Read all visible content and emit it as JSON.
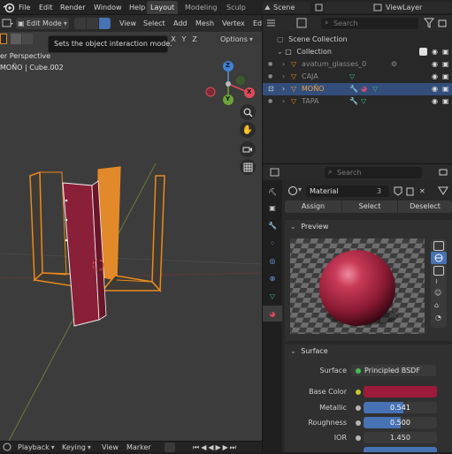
{
  "menu": {
    "file": "File",
    "edit": "Edit",
    "render": "Render",
    "window": "Window",
    "help": "Help"
  },
  "workspaces": [
    "Layout",
    "Modeling",
    "Sculp"
  ],
  "scene": {
    "name": "Scene",
    "view_layer": "ViewLayer"
  },
  "viewport": {
    "mode": "Edit Mode",
    "view_menu": "View",
    "select_menu": "Select",
    "add_menu": "Add",
    "mesh_menu": "Mesh",
    "vertex_menu": "Vertex",
    "edge_menu": "Ed",
    "axes": [
      "X",
      "Y",
      "Z"
    ],
    "options": "Options",
    "perspective": "er Perspective",
    "object_info": "MOÑO | Cube.002",
    "tooltip": "Sets the object interaction mode.",
    "gizmo": {
      "x": "X",
      "y": "Y",
      "z": "Z"
    }
  },
  "outliner": {
    "search_placeholder": "Search",
    "scene_collection": "Scene Collection",
    "collection": "Collection",
    "items": [
      "avatum_glasses_0",
      "CAJA",
      "MOÑO",
      "TAPA"
    ]
  },
  "properties": {
    "search_placeholder": "Search",
    "material_name": "Material",
    "material_users": "3",
    "assign": "Assign",
    "select": "Select",
    "deselect": "Deselect",
    "preview_header": "Preview",
    "surface_header": "Surface",
    "surface_label": "Surface",
    "surface_value": "Principled BSDF",
    "base_color_label": "Base Color",
    "base_color": "#9c1b3a",
    "metallic_label": "Metallic",
    "metallic_value": "0.541",
    "metallic_fraction": 0.541,
    "roughness_label": "Roughness",
    "roughness_value": "0.500",
    "roughness_fraction": 0.5,
    "ior_label": "IOR",
    "ior_value": "1.450"
  },
  "timeline": {
    "playback": "Playback",
    "keying": "Keying",
    "view": "View",
    "marker": "Marker"
  },
  "colors": {
    "accent_blue": "#4772b3",
    "selection_orange": "#e88a1e",
    "material_red": "#9c1b3a"
  }
}
